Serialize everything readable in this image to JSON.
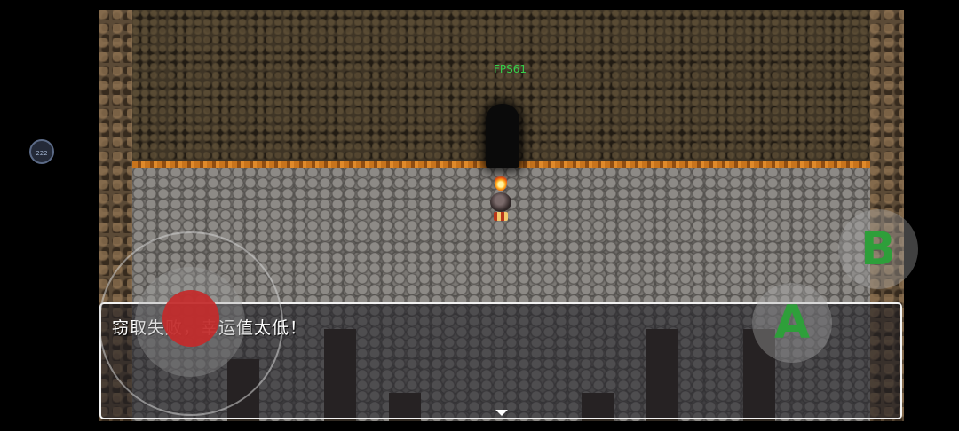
{
  "hud": {
    "fps_text": "FPS61",
    "float_button_label": "222"
  },
  "dialog": {
    "message": "窃取失败，幸运值太低！"
  },
  "controls": {
    "button_a_label": "A",
    "button_b_label": "B"
  },
  "colors": {
    "fps_text": "#35d04a",
    "joystick_thumb": "#c42a2a",
    "action_letters": "#2e9f3a",
    "wall_edge": "#c8741c"
  }
}
